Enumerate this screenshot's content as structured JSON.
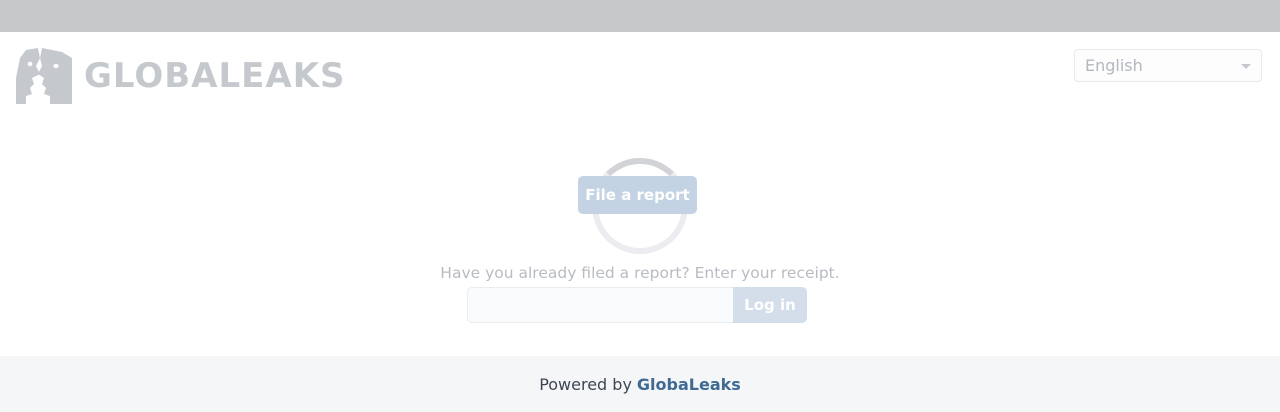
{
  "app": {
    "logo_text": "GLOBALEAKS"
  },
  "header": {
    "language_selected": "English"
  },
  "main": {
    "file_report_label": "File a report",
    "receipt_prompt": "Have you already filed a report? Enter your receipt.",
    "receipt_value": "",
    "login_label": "Log in"
  },
  "footer": {
    "powered_by": "Powered by",
    "brand": "GlobaLeaks"
  },
  "colors": {
    "topbar": "#c7c8ca",
    "logo": "#c5c8cc",
    "button": "#c4d3e3",
    "brand_link": "#3e6a93"
  },
  "icons": {
    "logo": "globaleaks-faces-icon",
    "select": "chevron-down-icon",
    "loading": "spinner-icon"
  }
}
